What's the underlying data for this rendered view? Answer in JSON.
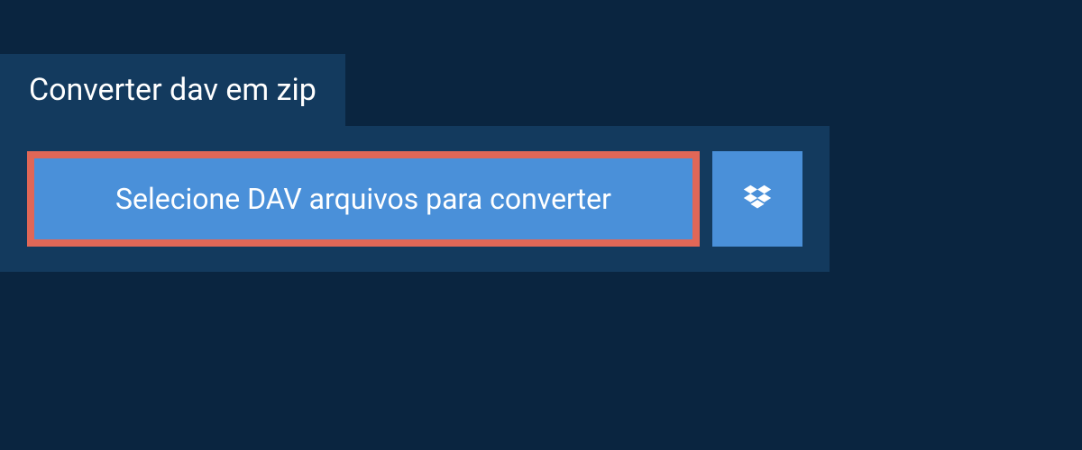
{
  "header": {
    "tab_title": "Converter dav em zip"
  },
  "upload": {
    "select_button_label": "Selecione DAV arquivos para converter",
    "dropbox_icon": "dropbox-icon"
  },
  "colors": {
    "page_bg": "#0a2540",
    "panel_bg": "#133a5e",
    "button_bg": "#4a90d9",
    "highlight_border": "#e06757"
  }
}
